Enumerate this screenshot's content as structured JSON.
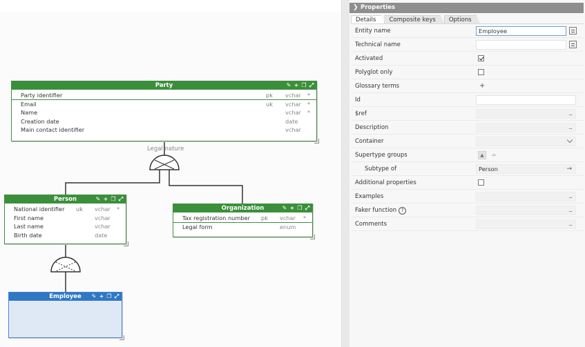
{
  "canvas": {
    "legal_nature_label": "Legal nature"
  },
  "entities": {
    "party": {
      "title": "Party",
      "fields": [
        {
          "name": "Party identifier",
          "key": "pk",
          "type": "vchar",
          "req": "*"
        },
        {
          "name": "Email",
          "key": "uk",
          "type": "vchar",
          "req": "*"
        },
        {
          "name": "Name",
          "key": "",
          "type": "vchar",
          "req": "*"
        },
        {
          "name": "Creation date",
          "key": "",
          "type": "date",
          "req": ""
        },
        {
          "name": "Main contact identifier",
          "key": "",
          "type": "vchar",
          "req": ""
        }
      ]
    },
    "person": {
      "title": "Person",
      "fields": [
        {
          "name": "National identifier",
          "key": "uk",
          "type": "vchar",
          "req": "*"
        },
        {
          "name": "First name",
          "key": "",
          "type": "vchar",
          "req": ""
        },
        {
          "name": "Last name",
          "key": "",
          "type": "vchar",
          "req": ""
        },
        {
          "name": "Birth date",
          "key": "",
          "type": "date",
          "req": ""
        }
      ]
    },
    "organization": {
      "title": "Organization",
      "fields": [
        {
          "name": "Tax registration number",
          "key": "pk",
          "type": "vchar",
          "req": "*"
        },
        {
          "name": "Legal form",
          "key": "",
          "type": "enum",
          "req": ""
        }
      ]
    },
    "employee": {
      "title": "Employee",
      "fields": []
    }
  },
  "properties": {
    "title": "Properties",
    "tabs": [
      "Details",
      "Composite keys",
      "Options"
    ],
    "active_tab": "Details",
    "rows": {
      "entity_name": {
        "label": "Entity name",
        "value": "Employee"
      },
      "technical_name": {
        "label": "Technical name",
        "value": ""
      },
      "activated": {
        "label": "Activated",
        "checked": true
      },
      "polyglot_only": {
        "label": "Polyglot only",
        "checked": false
      },
      "glossary_terms": {
        "label": "Glossary terms"
      },
      "id": {
        "label": "Id",
        "value": ""
      },
      "ref": {
        "label": "$ref",
        "value": ""
      },
      "description": {
        "label": "Description",
        "value": ""
      },
      "container": {
        "label": "Container",
        "value": ""
      },
      "supertype_groups": {
        "label": "Supertype groups"
      },
      "subtype_of": {
        "label": "Subtype of",
        "value": "Person"
      },
      "additional_properties": {
        "label": "Additional properties",
        "checked": false
      },
      "examples": {
        "label": "Examples",
        "value": ""
      },
      "faker_function": {
        "label": "Faker function",
        "value": ""
      },
      "comments": {
        "label": "Comments",
        "value": ""
      }
    },
    "dots_label": "...",
    "help_glyph": "?"
  }
}
